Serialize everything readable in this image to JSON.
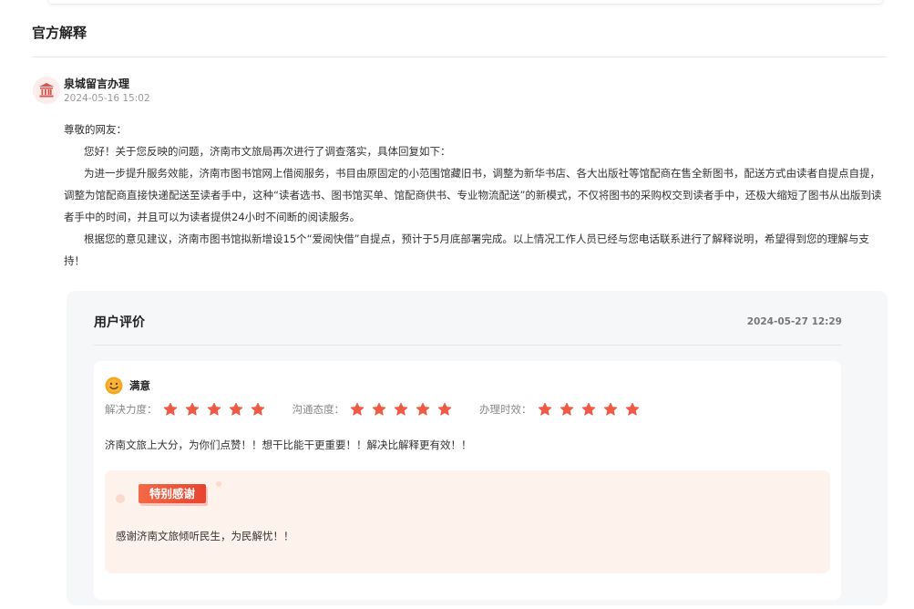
{
  "section": {
    "title": "官方解释"
  },
  "reply": {
    "org_name": "泉城留言办理",
    "time": "2024-05-16 15:02",
    "greeting": "尊敬的网友：",
    "paragraphs": [
      "您好！关于您反映的问题，济南市文旅局再次进行了调查落实，具体回复如下：",
      "为进一步提升服务效能，济南市图书馆网上借阅服务，书目由原固定的小范围馆藏旧书，调整为新华书店、各大出版社等馆配商在售全新图书，配送方式由读者自提点自提，调整为馆配商直接快递配送至读者手中，这种“读者选书、图书馆买单、馆配商供书、专业物流配送”的新模式，不仅将图书的采购权交到读者手中，还极大缩短了图书从出版到读者手中的时间，并且可以为读者提供24小时不间断的阅读服务。",
      "根据您的意见建议，济南市图书馆拟新增设15个“爱阅快借”自提点，预计于5月底部署完成。以上情况工作人员已经与您电话联系进行了解释说明，希望得到您的理解与支持！"
    ]
  },
  "review": {
    "title": "用户评价",
    "time": "2024-05-27 12:29",
    "satisfaction": "满意",
    "ratings": [
      {
        "label": "解决力度：",
        "stars": 5
      },
      {
        "label": "沟通态度：",
        "stars": 5
      },
      {
        "label": "办理时效：",
        "stars": 5
      }
    ],
    "comment": "济南文旅上大分，为你们点赞！！想干比能干更重要！！解决比解释更有效！！",
    "thanks_badge": "特别感谢",
    "thanks_text": "感谢济南文旅倾听民生，为民解忧！！"
  },
  "colors": {
    "accent": "#e8442f",
    "star": "#ef5a45",
    "smile": "#f5a623"
  },
  "icons": {
    "org_avatar": "government-building-icon",
    "satisfaction": "smile-face-icon",
    "rating": "star-icon"
  }
}
